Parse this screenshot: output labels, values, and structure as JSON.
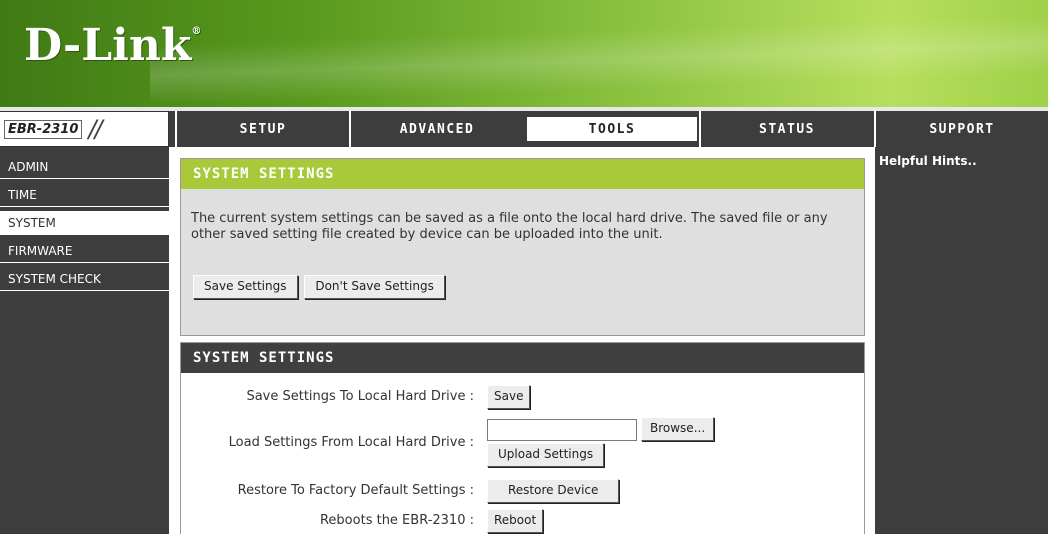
{
  "brand": {
    "logo_text": "D-Link",
    "reg_mark": "®",
    "model": "EBR-2310",
    "model_slashes": "//"
  },
  "nav": {
    "tabs": [
      {
        "label": "SETUP"
      },
      {
        "label": "ADVANCED"
      },
      {
        "label": "TOOLS",
        "active": true
      },
      {
        "label": "STATUS"
      },
      {
        "label": "SUPPORT"
      }
    ]
  },
  "sidebar": {
    "items": [
      {
        "label": "ADMIN"
      },
      {
        "label": "TIME"
      },
      {
        "label": "SYSTEM",
        "active": true
      },
      {
        "label": "FIRMWARE"
      },
      {
        "label": "SYSTEM CHECK"
      }
    ]
  },
  "hints": {
    "title": "Helpful Hints.."
  },
  "panel1": {
    "title": "SYSTEM SETTINGS",
    "description": "The current system settings can be saved as a file onto the local hard drive. The saved file or any other saved setting file created by device can be uploaded into the unit.",
    "save_button": "Save Settings",
    "dont_save_button": "Don't Save Settings"
  },
  "panel2": {
    "title": "SYSTEM SETTINGS",
    "save_label": "Save Settings To Local Hard Drive :",
    "save_button": "Save",
    "load_label": "Load Settings From Local Hard Drive :",
    "file_value": "",
    "browse_button": "Browse...",
    "upload_button": "Upload Settings",
    "restore_label": "Restore To Factory Default Settings :",
    "restore_button": "Restore Device",
    "reboot_label": "Reboots the EBR-2310 :",
    "reboot_button": "Reboot"
  },
  "colors": {
    "brand_green": "#5a9a1e",
    "title_green": "#a9c83a",
    "nav_dark": "#3d3d3d"
  }
}
